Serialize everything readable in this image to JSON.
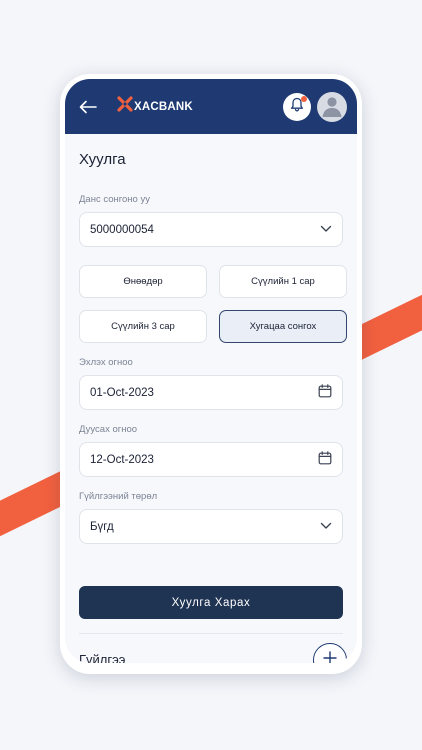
{
  "header": {
    "logo_text": "XACBANK"
  },
  "page": {
    "title": "Хуулга"
  },
  "account": {
    "label": "Данс сонгоно уу",
    "value": "5000000054"
  },
  "periods": [
    {
      "label": "Өнөөдөр",
      "active": false
    },
    {
      "label": "Сүүлийн 1 сар",
      "active": false
    },
    {
      "label": "Сүүлийн 3 сар",
      "active": false
    },
    {
      "label": "Хугацаа сонгох",
      "active": true
    }
  ],
  "start_date": {
    "label": "Эхлэх огноо",
    "value": "01-Oct-2023"
  },
  "end_date": {
    "label": "Дуусах огноо",
    "value": "12-Oct-2023"
  },
  "transaction_type": {
    "label": "Гүйлгээний төрөл",
    "value": "Бүгд"
  },
  "actions": {
    "view_statement": "Хуулга Харах"
  },
  "transactions": {
    "title": "Гүйлгээ"
  },
  "colors": {
    "brand_navy": "#1f3a72",
    "accent_orange": "#f2613f",
    "button_dark": "#1f3352"
  },
  "icons": [
    "back-arrow-icon",
    "xacbank-logo-icon",
    "bell-icon",
    "user-icon",
    "chevron-down-icon",
    "calendar-icon",
    "plus-icon"
  ]
}
